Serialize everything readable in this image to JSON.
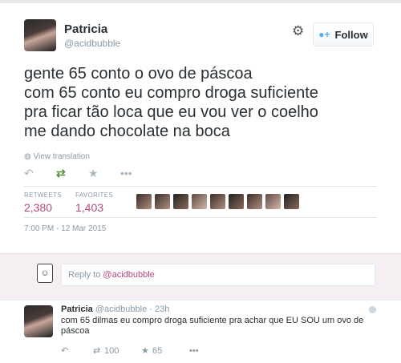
{
  "tweet": {
    "name": "Patricia",
    "handle": "@acidbubble",
    "follow_label": "Follow",
    "text": "gente 65 conto o ovo de páscoa\ncom 65 conto eu compro droga suficiente\npra ficar tão loca que eu vou ver o coelho\nme dando chocolate na boca",
    "translate": "View translation",
    "retweets_label": "RETWEETS",
    "retweets": "2,380",
    "favorites_label": "FAVORITES",
    "favorites": "1,403",
    "timestamp": "7:00 PM - 12 Mar 2015"
  },
  "reply_box": {
    "prefix": "Reply to ",
    "mention": "@acidbubble"
  },
  "reply": {
    "name": "Patricia",
    "meta": "@acidbubble · 23h",
    "text": "com 65 dilmas eu compro droga suficiente pra achar que EU SOU um ovo de páscoa",
    "retweets": "100",
    "favorites": "65"
  },
  "colors": {
    "accent": "#b3497d",
    "retweet": "#5c913b",
    "link_blue": "#55acee"
  }
}
